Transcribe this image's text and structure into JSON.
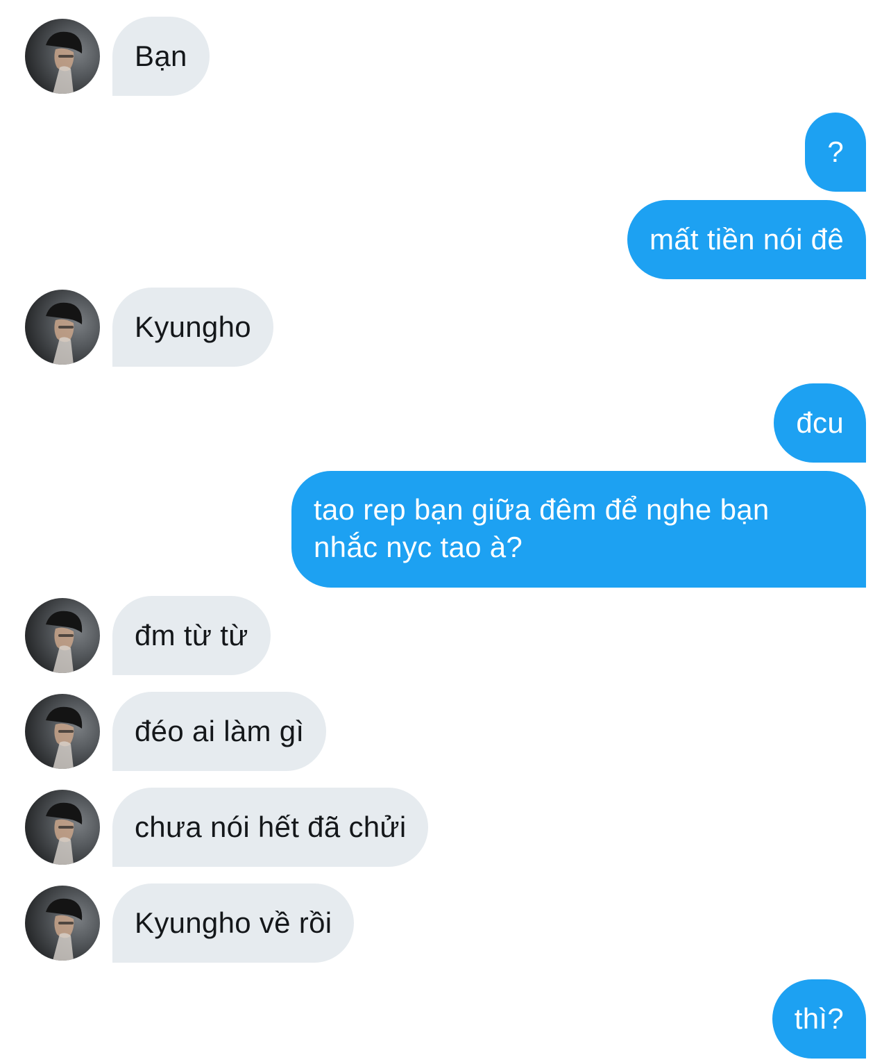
{
  "messages": [
    {
      "side": "in",
      "text": "Bạn"
    },
    {
      "side": "out",
      "text": "?"
    },
    {
      "side": "out",
      "text": "mất tiền nói đê"
    },
    {
      "side": "in",
      "text": "Kyungho"
    },
    {
      "side": "out",
      "text": "đcu"
    },
    {
      "side": "out",
      "text": "tao rep bạn giữa đêm để nghe bạn nhắc nyc tao à?"
    },
    {
      "side": "in",
      "text": "đm từ từ"
    },
    {
      "side": "in",
      "text": "đéo ai làm gì"
    },
    {
      "side": "in",
      "text": "chưa nói hết đã chửi"
    },
    {
      "side": "in",
      "text": "Kyungho về rồi"
    },
    {
      "side": "out",
      "text": "thì?"
    }
  ],
  "colors": {
    "incoming_bubble": "#e6ebef",
    "outgoing_bubble": "#1da1f2",
    "incoming_text": "#14171a",
    "outgoing_text": "#ffffff"
  }
}
